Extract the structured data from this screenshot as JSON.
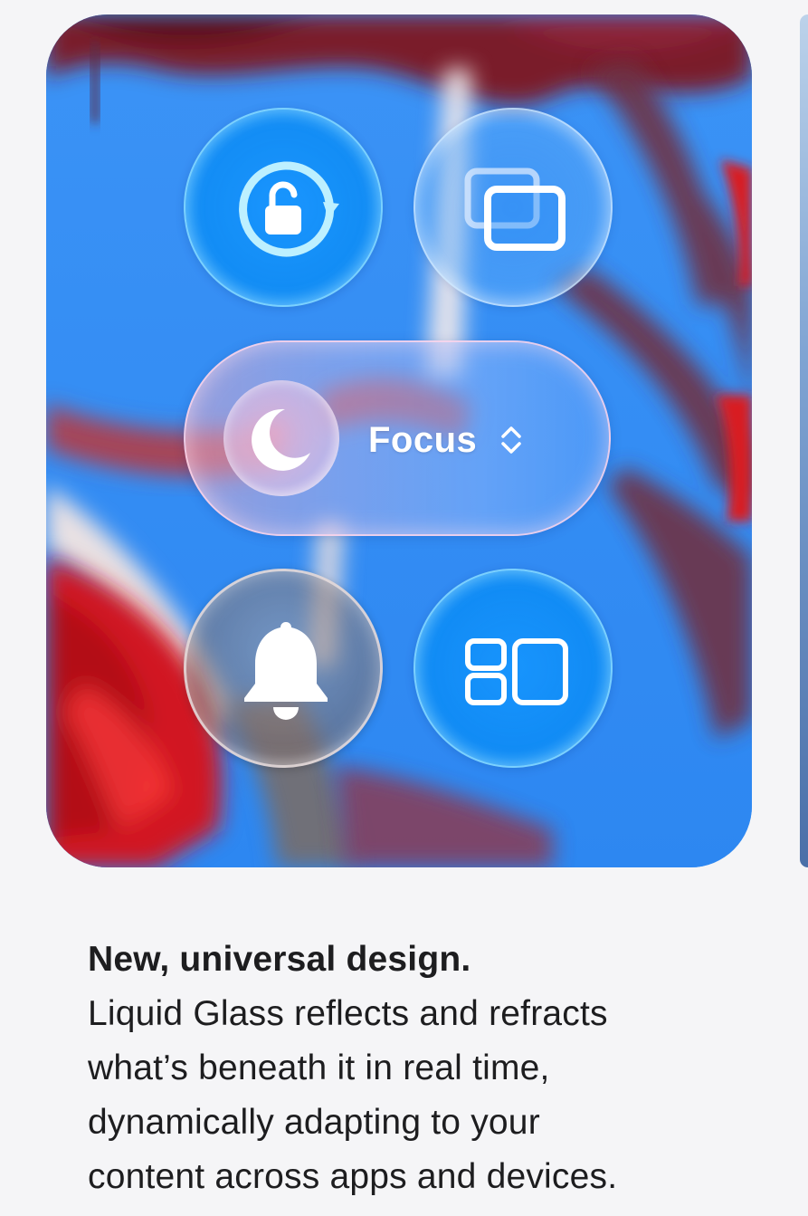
{
  "hero": {
    "controls": {
      "rotation_lock": {
        "icon": "rotation-lock-icon"
      },
      "screen_mirroring": {
        "icon": "screen-mirroring-icon"
      },
      "focus": {
        "label": "Focus",
        "icon": "moon-icon",
        "chevron": "up-down-chevron-icon"
      },
      "silent_mode": {
        "icon": "bell-icon"
      },
      "stage_manager": {
        "icon": "stage-manager-icon"
      }
    },
    "colors": {
      "sky_blue": "#2f8cf4",
      "red_foliage": "#d8141e",
      "glass_blue": "#0f96ff"
    }
  },
  "copy": {
    "headline": "New, universal design.",
    "body_lines": [
      "Liquid Glass reflects and refracts",
      "what’s beneath it in real time,",
      "dynamically adapting to your",
      "content across apps and devices."
    ]
  }
}
